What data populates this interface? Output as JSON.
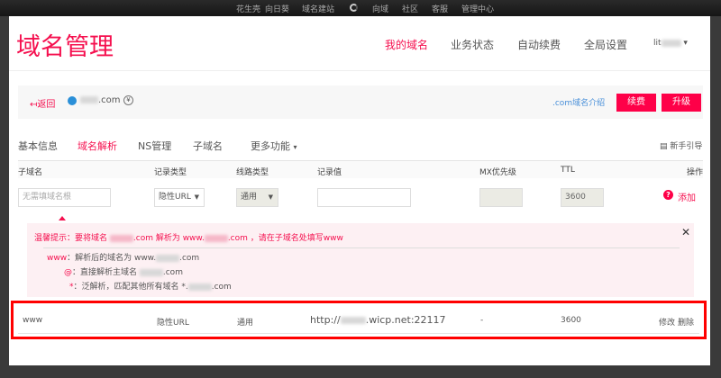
{
  "topnav": [
    "花生壳",
    "向日葵",
    "域名建站",
    "向域",
    "社区",
    "客服",
    "管理中心"
  ],
  "header": {
    "title": "域名管理",
    "nav": [
      "我的域名",
      "业务状态",
      "自动续费",
      "全局设置"
    ],
    "user": "lit"
  },
  "domain_bar": {
    "back": "返回",
    "domain_suffix": ".com",
    "intro_link": ".com域名介绍",
    "renew": "续费",
    "upgrade": "升级"
  },
  "tabs": [
    "基本信息",
    "域名解析",
    "NS管理",
    "子域名",
    "更多功能"
  ],
  "guide": "新手引导",
  "columns": [
    "子域名",
    "记录类型",
    "线路类型",
    "记录值",
    "MX优先级",
    "TTL",
    "操作"
  ],
  "form": {
    "subdomain_placeholder": "无需填域名根",
    "record_type": "隐性URL",
    "line_type": "通用",
    "value": "",
    "mx": "",
    "ttl": "3600",
    "add": "添加"
  },
  "tip": {
    "title_a": "温馨提示：要将域名",
    "title_b": ".com 解析为 www.",
    "title_c": ".com ，请在子域名处填写www",
    "lines": [
      {
        "key": "www",
        "text": "：解析后的域名为 www.",
        "suffix": ".com"
      },
      {
        "key": "@",
        "text": "：直接解析主域名 ",
        "suffix": ".com"
      },
      {
        "key": "*",
        "text": "：泛解析，匹配其他所有域名 *.",
        "suffix": ".com"
      }
    ]
  },
  "record": {
    "sub": "www",
    "type": "隐性URL",
    "line": "通用",
    "value_prefix": "http://",
    "value_suffix": ".wicp.net:22117",
    "mx": "-",
    "ttl": "3600",
    "edit": "修改",
    "delete": "删除"
  },
  "colors": {
    "accent": "#fe0048",
    "highlight": "#ff0000"
  }
}
